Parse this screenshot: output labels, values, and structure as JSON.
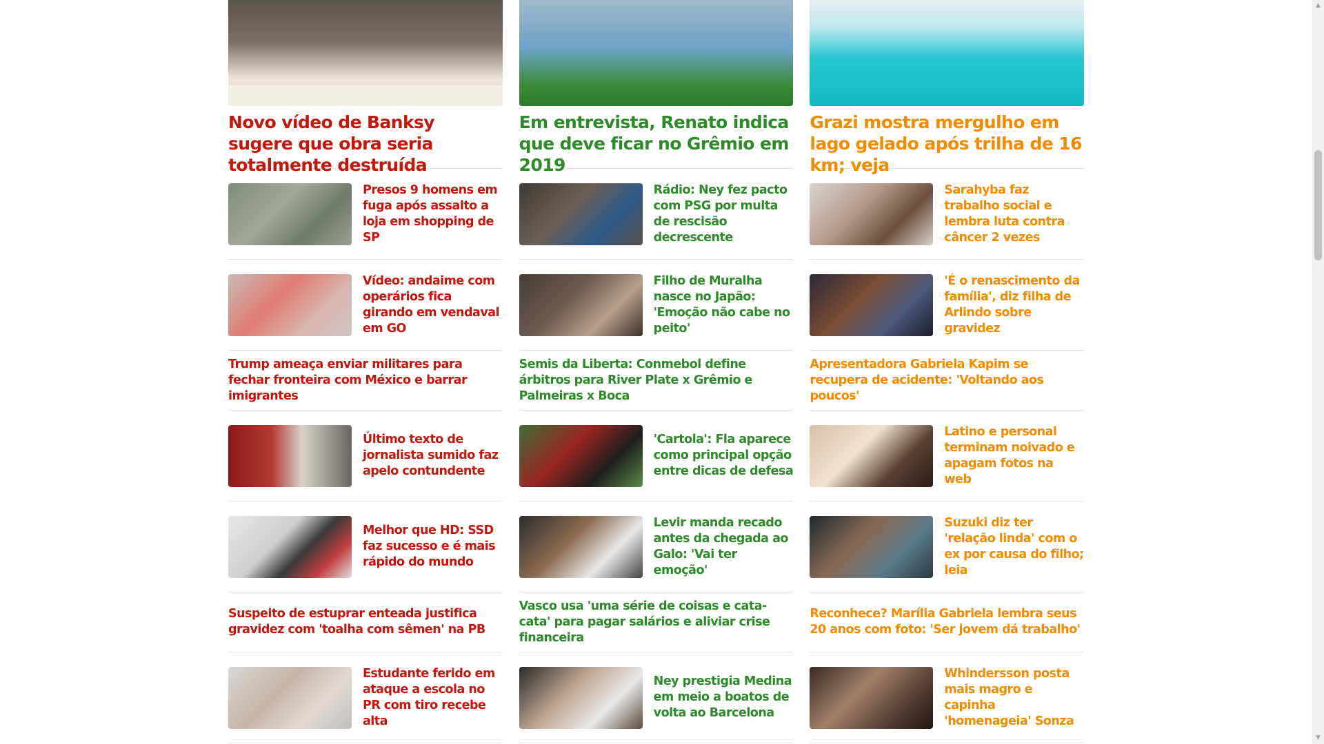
{
  "columns": [
    {
      "color": "#c4170c",
      "hero": {
        "image": "banksy-auction-photo",
        "title": "Novo vídeo de Banksy sugere que obra seria totalmente destruída"
      },
      "rows": [
        {
          "type": "thumb",
          "image": "aerial-shopping-photo",
          "title": "Presos 9 homens em fuga após assalto a loja em shopping de SP"
        },
        {
          "type": "thumb",
          "image": "scaffold-video-photo",
          "title": "Vídeo: andaime com operários fica girando em vendaval em GO"
        },
        {
          "type": "text",
          "title": "Trump ameaça enviar militares para fechar fronteira com México e barrar imigrantes"
        },
        {
          "type": "thumb",
          "image": "journalist-photo",
          "title": "Último texto de jornalista sumido faz apelo contundente"
        },
        {
          "type": "thumb",
          "image": "ssd-photo",
          "title": "Melhor que HD: SSD faz sucesso e é mais rápido do mundo"
        },
        {
          "type": "text",
          "title": "Suspeito de estuprar enteada justifica gravidez com 'toalha com sêmen' na PB"
        },
        {
          "type": "thumb",
          "image": "student-photo",
          "title": "Estudante ferido em ataque a escola no PR com tiro recebe alta"
        }
      ]
    },
    {
      "color": "#2d8a29",
      "hero": {
        "image": "renato-interview-photo",
        "title": "Em entrevista, Renato indica que deve ficar no Grêmio em 2019"
      },
      "rows": [
        {
          "type": "thumb",
          "image": "ney-pact-photo",
          "title": "Rádio: Ney fez pacto com PSG por multa de rescisão decrescente"
        },
        {
          "type": "thumb",
          "image": "muralha-baby-photo",
          "title": "Filho de Muralha nasce no Japão: 'Emoção não cabe no peito'"
        },
        {
          "type": "text",
          "title": "Semis da Liberta: Conmebol define árbitros para River Plate x Grêmio e Palmeiras x Boca"
        },
        {
          "type": "thumb",
          "image": "cartola-photo",
          "title": "'Cartola': Fla aparece como principal opção entre dicas de defesa"
        },
        {
          "type": "thumb",
          "image": "levir-photo",
          "title": "Levir manda recado antes da chegada ao Galo: 'Vai ter emoção'"
        },
        {
          "type": "text",
          "title": "Vasco usa 'uma série de coisas e cata-cata' para pagar salários e aliviar crise financeira"
        },
        {
          "type": "thumb",
          "image": "medina-ney-photo",
          "title": "Ney prestigia Medina em meio a boatos de volta ao Barcelona"
        }
      ]
    },
    {
      "color": "#f28b00",
      "hero": {
        "image": "grazi-lake-photo",
        "title": "Grazi mostra mergulho em lago gelado após trilha de 16 km; veja"
      },
      "rows": [
        {
          "type": "thumb",
          "image": "sarahyba-photo",
          "title": "Sarahyba faz trabalho social e lembra luta contra câncer 2 vezes"
        },
        {
          "type": "thumb",
          "image": "arlindo-photo",
          "title": "'É o renascimento da família', diz filha de Arlindo sobre gravidez"
        },
        {
          "type": "text",
          "title": "Apresentadora Gabriela Kapim se recupera de acidente: 'Voltando aos poucos'"
        },
        {
          "type": "thumb",
          "image": "latino-photo",
          "title": "Latino e personal terminam noivado e apagam fotos na web"
        },
        {
          "type": "thumb",
          "image": "suzuki-photo",
          "title": "Suzuki diz ter 'relação linda' com o ex por causa do filho; leia"
        },
        {
          "type": "text",
          "title": "Reconhece? Marília Gabriela lembra seus 20 anos com foto: 'Ser jovem dá trabalho'"
        },
        {
          "type": "thumb",
          "image": "whindersson-photo",
          "title": "Whindersson posta mais magro e capinha 'homenageia' Sonza"
        }
      ]
    }
  ],
  "scrollbar": {
    "up_icon": "scroll-up-arrow-icon",
    "down_icon": "scroll-down-arrow-icon"
  }
}
